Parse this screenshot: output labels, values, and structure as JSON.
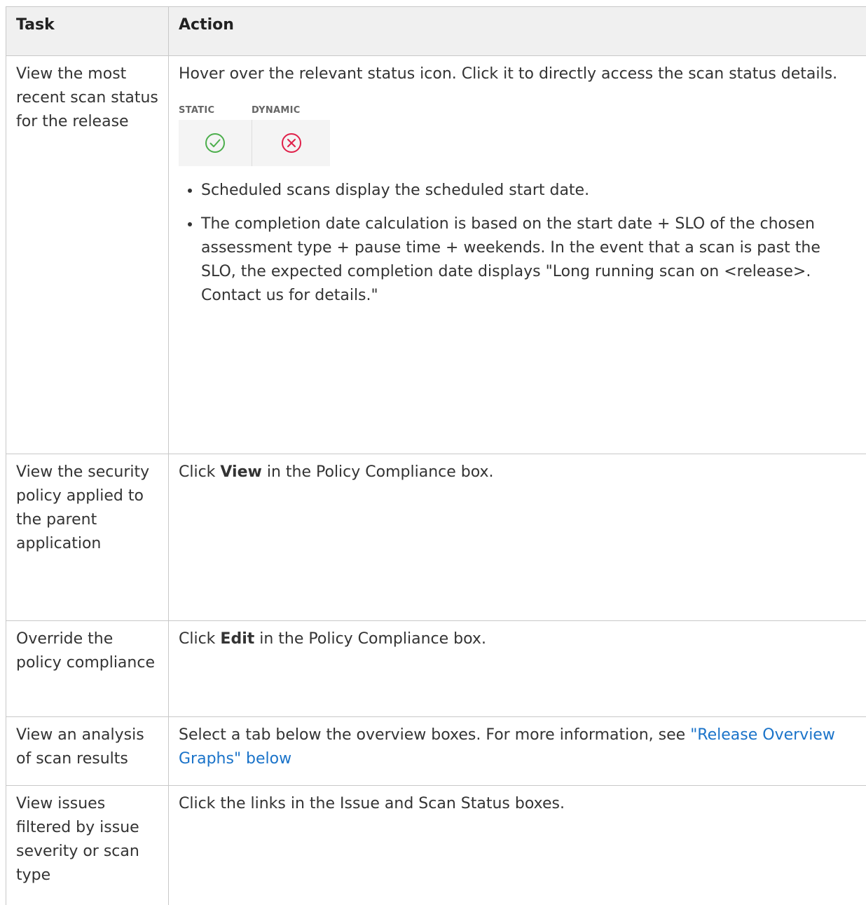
{
  "table": {
    "header": {
      "task": "Task",
      "action": "Action"
    },
    "rows": [
      {
        "task": "View the most recent scan status for the release",
        "action_text": "Hover over the relevant status icon. Click it to directly access the scan status details.",
        "figure": {
          "static_label": "STATIC",
          "dynamic_label": "DYNAMIC",
          "static_icon": "check-circle-icon",
          "dynamic_icon": "x-circle-icon",
          "static_color": "#4cae4c",
          "dynamic_color": "#e0204a"
        },
        "bullets": [
          "Scheduled scans display the scheduled start date.",
          "The completion date calculation is based on the start date + SLO of the chosen assessment type + pause time + weekends. In the event that a scan is past the SLO, the expected completion date displays \"Long running scan on <release>. Contact us for details.\""
        ]
      },
      {
        "task": "View the security policy applied to the parent application",
        "action_prefix": "Click ",
        "action_bold": "View",
        "action_suffix": " in the Policy Compliance box."
      },
      {
        "task": "Override the policy compliance",
        "action_prefix": "Click ",
        "action_bold": "Edit",
        "action_suffix": " in the Policy Compliance box."
      },
      {
        "task": "View an analysis of scan results",
        "action_prefix": "Select a tab below the overview boxes. For more information, see ",
        "action_link": "\"Release Overview Graphs\" below",
        "link_color": "#1a73c9"
      },
      {
        "task": "View issues filtered by issue severity or scan type",
        "action_text": "Click the links in the Issue and Scan Status boxes."
      }
    ]
  }
}
